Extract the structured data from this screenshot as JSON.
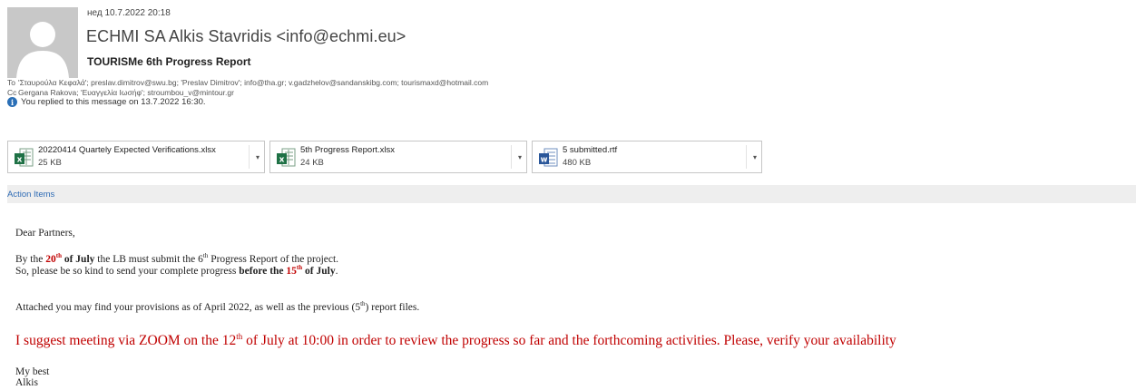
{
  "header": {
    "date": "нед 10.7.2022 20:18",
    "from": "ECHMI SA Alkis Stavridis <info@echmi.eu>",
    "subject": "TOURISMe 6th Progress Report"
  },
  "recipients": {
    "to_label": "To",
    "to_value": "'Σταυρούλα Κεφαλά'; preslav.dimitrov@swu.bg; 'Preslav Dimitrov'; info@tha.gr; v.gadzhelov@sandanskibg.com; tourismaxd@hotmail.com",
    "cc_label": "Cc",
    "cc_value": "Gergana Rakova; 'Ευαγγελία Ιωσήφ'; stroumbou_v@mintour.gr"
  },
  "info": {
    "text": "You replied to this message on 13.7.2022 16:30."
  },
  "attachments": [
    {
      "name": "20220414 Quartely Expected Verifications.xlsx",
      "size": "25 KB",
      "icon": "excel-file-icon"
    },
    {
      "name": "5th Progress Report.xlsx",
      "size": "24 KB",
      "icon": "excel-file-icon"
    },
    {
      "name": "5 submitted.rtf",
      "size": "480 KB",
      "icon": "word-file-icon"
    }
  ],
  "action_items": {
    "label": "Action Items"
  },
  "body": {
    "greeting": "Dear Partners,",
    "p1_a": "By the ",
    "p1_date_num": "20",
    "p1_date_sup": "th",
    "p1_date_rest": " of July",
    "p1_b": " the LB must submit the 6",
    "p1_b_sup": "th",
    "p1_c": " Progress Report of the project.",
    "p2_a": "So, please be so kind to send your complete progress ",
    "p2_bold": "before the ",
    "p2_num": "15",
    "p2_sup": "th",
    "p2_rest": " of July",
    "p2_end": ".",
    "p3_a": "Attached you may find your provisions as of April 2022, as well as the previous (5",
    "p3_sup": "th",
    "p3_b": ") report files.",
    "p4_a": "I suggest meeting via ZOOM on the 12",
    "p4_sup": "th",
    "p4_b": " of July at 10:00 in order to review the progress so far and the forthcoming activities. Please, verify your availability",
    "sign1": "My best",
    "sign2": "Alkis"
  },
  "colors": {
    "accent_link": "#2e6bb5",
    "emphasis_red": "#c00000",
    "excel_green": "#1e7145",
    "word_blue": "#2b579a"
  }
}
